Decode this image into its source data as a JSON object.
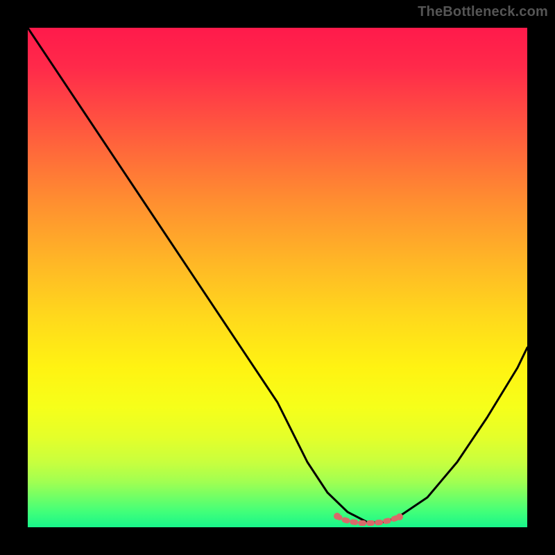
{
  "watermark": "TheBottleneck.com",
  "chart_data": {
    "type": "line",
    "title": "",
    "xlabel": "",
    "ylabel": "",
    "xlim": [
      0,
      100
    ],
    "ylim": [
      0,
      100
    ],
    "grid": false,
    "legend": false,
    "series": [
      {
        "name": "bottleneck-curve",
        "x": [
          0,
          10,
          20,
          30,
          40,
          50,
          56,
          60,
          64,
          68,
          71,
          74,
          80,
          86,
          92,
          98,
          100
        ],
        "values": [
          100,
          85,
          70,
          55,
          40,
          25,
          13,
          7,
          3,
          1,
          1,
          2,
          6,
          13,
          22,
          32,
          36
        ]
      }
    ],
    "annotations": [
      {
        "name": "optimal-band",
        "x_start": 62,
        "x_end": 75,
        "y": 2,
        "color": "#d96a6a"
      }
    ],
    "background_gradient": {
      "top_color": "#ff1a4b",
      "bottom_color": "#18f58a"
    }
  }
}
